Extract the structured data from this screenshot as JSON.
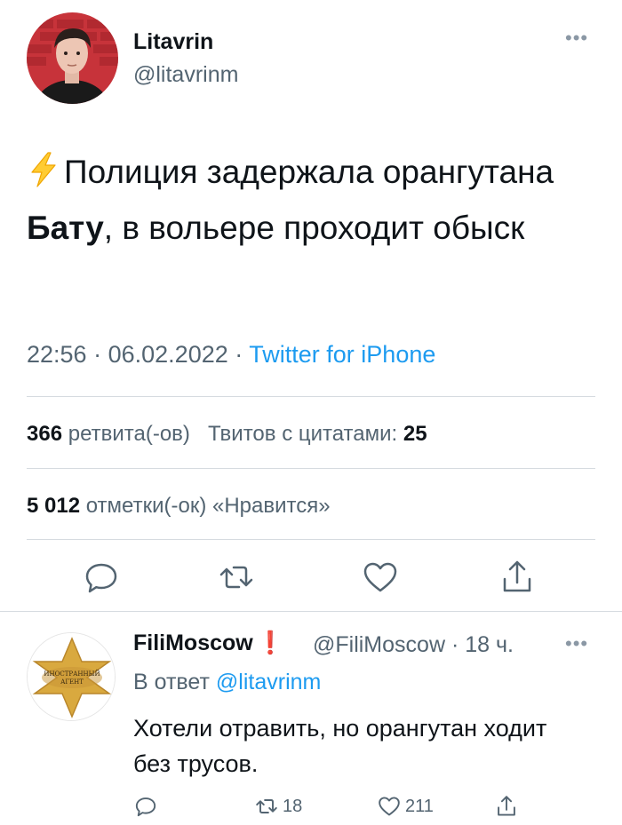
{
  "tweet": {
    "author_name": "Litavrin",
    "author_handle": "@litavrinm",
    "text_part1": "Полиция задержала орангутана ",
    "text_bold": "Бату",
    "text_part2": ", в вольере проходит обыск",
    "time": "22:56",
    "date": "06.02.2022",
    "separator": "·",
    "source": "Twitter for iPhone",
    "retweets_count": "366",
    "retweets_label": "ретвита(-ов)",
    "quotes_label": "Твитов с цитатами:",
    "quotes_count": "25",
    "likes_count": "5 012",
    "likes_label": "отметки(-ок) «Нравится»",
    "more_icon": "more-dots-icon",
    "lead_icon": "lightning-bolt-icon"
  },
  "actions": {
    "reply_icon": "reply-icon",
    "retweet_icon": "retweet-icon",
    "like_icon": "heart-icon",
    "share_icon": "share-icon"
  },
  "reply": {
    "author_name": "FiliMoscow",
    "badge": "❗",
    "author_handle": "@FiliMoscow",
    "time": "18 ч.",
    "separator": "·",
    "reply_to_label": "В ответ",
    "reply_to_handle": "@litavrinm",
    "text": "Хотели отравить, но орангутан ходит без трусов.",
    "retweets": "18",
    "likes": "211",
    "avatar_text_line1": "ИНОСТРАННЫЙ",
    "avatar_text_line2": "АГЕНТ"
  },
  "colors": {
    "text": "#0f1419",
    "secondary": "#536471",
    "link": "#1d9bf0",
    "divider": "#d6dbe0",
    "star": "#d9a93f",
    "excl": "#e0245e"
  }
}
